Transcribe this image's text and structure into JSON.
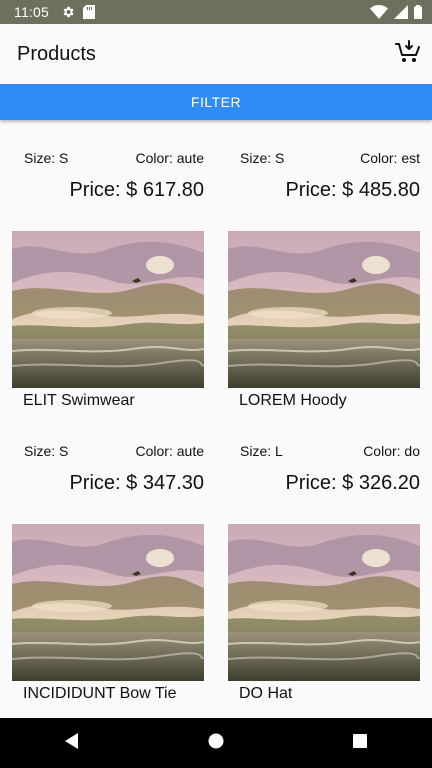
{
  "status_bar": {
    "time": "11:05",
    "left_icons": [
      "gear-icon",
      "sd-card-icon"
    ],
    "right_icons": [
      "wifi-icon",
      "signal-icon",
      "battery-icon"
    ]
  },
  "app_bar": {
    "title": "Products",
    "cart_icon": "cart-download-icon"
  },
  "filter_button": {
    "label": "FILTER",
    "color": "#2f8cf7"
  },
  "products": [
    {
      "size": "Size: S",
      "color": "Color: aute",
      "price": "Price: $ 617.80",
      "name": "ELIT Swimwear"
    },
    {
      "size": "Size: S",
      "color": "Color: est",
      "price": "Price: $ 485.80",
      "name": "LOREM Hoody"
    },
    {
      "size": "Size: S",
      "color": "Color: aute",
      "price": "Price: $ 347.30",
      "name": "INCIDIDUNT Bow Tie"
    },
    {
      "size": "Size: L",
      "color": "Color: do",
      "price": "Price: $ 326.20",
      "name": "DO Hat"
    }
  ],
  "nav_bar": {
    "buttons": [
      "back-icon",
      "home-icon",
      "recents-icon"
    ]
  }
}
